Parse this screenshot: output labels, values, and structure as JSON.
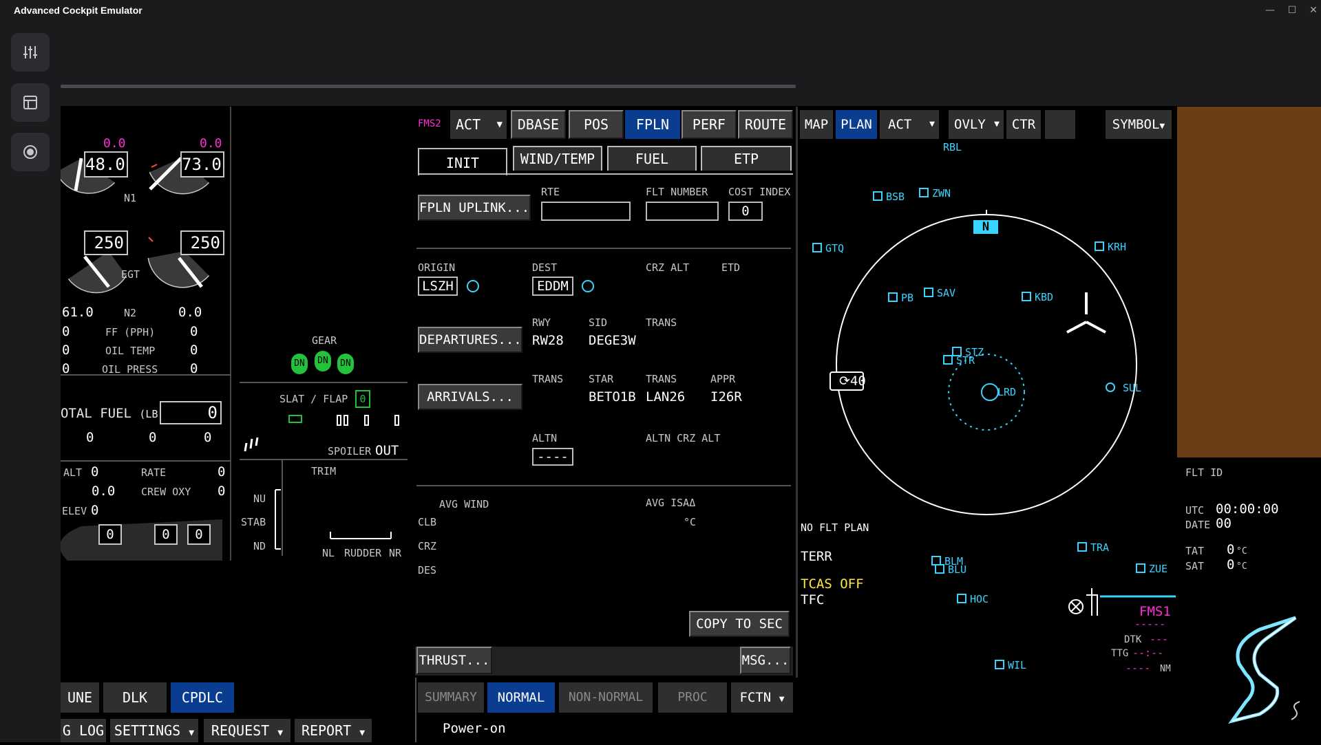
{
  "app": {
    "title": "Advanced Cockpit Emulator"
  },
  "window": {
    "minimize": "—",
    "maximize": "☐",
    "close": "✕"
  },
  "sidebar": {
    "items": [
      {
        "icon": "sliders-icon"
      },
      {
        "icon": "layout-icon"
      },
      {
        "icon": "record-icon"
      }
    ]
  },
  "engine": {
    "n1_left_top": "0.0",
    "n1_right_top": "0.0",
    "n1_left": "48.0",
    "n1_right": "73.0",
    "n1_label": "N1",
    "egt_left": "250",
    "egt_right": "250",
    "egt_label": "EGT",
    "n2_left": "61.0",
    "n2_label": "N2",
    "n2_right": "0.0",
    "ff_left": "0",
    "ff_label": "FF (PPH)",
    "ff_right": "0",
    "oil_temp_left": "0",
    "oil_temp_label": "OIL TEMP",
    "oil_temp_right": "0",
    "oil_press_left": "0",
    "oil_press_label": "OIL PRESS",
    "oil_press_right": "0",
    "total_fuel_label": "OTAL FUEL",
    "total_fuel_unit": "(LB)",
    "total_fuel_value": "0",
    "fuel_tanks": [
      "0",
      "0",
      "0"
    ],
    "alt_label": "ALT",
    "alt_value": "0",
    "rate_label": "RATE",
    "rate_value": "0",
    "cab_value": "0.0",
    "crew_oxy_label": "CREW OXY",
    "crew_oxy_value": "0",
    "elev_label": "ELEV",
    "elev_value": "0",
    "bottom_boxes": [
      "0",
      "0",
      "0"
    ]
  },
  "gear": {
    "label": "GEAR",
    "states": [
      "DN",
      "DN",
      "DN"
    ],
    "slat_flap_label": "SLAT / FLAP",
    "slat_flap_value": "0",
    "spoiler_label": "SPOILER",
    "spoiler_value": "OUT",
    "trim_label": "TRIM",
    "trim_nu": "NU",
    "trim_stab": "STAB",
    "trim_nd": "ND",
    "rudder_nl": "NL",
    "rudder_label": "RUDDER",
    "rudder_nr": "NR"
  },
  "fms": {
    "label": "FMS2",
    "act": "ACT",
    "top_buttons": [
      "DBASE",
      "POS",
      "FPLN",
      "PERF",
      "ROUTE"
    ],
    "tabs": [
      "INIT",
      "WIND/TEMP",
      "FUEL",
      "ETP"
    ],
    "fpln_uplink": "FPLN UPLINK...",
    "rte_label": "RTE",
    "flt_number_label": "FLT NUMBER",
    "cost_index_label": "COST INDEX",
    "cost_index_value": "0",
    "origin_label": "ORIGIN",
    "origin_value": "LSZH",
    "dest_label": "DEST",
    "dest_value": "EDDM",
    "crz_alt_label": "CRZ ALT",
    "etd_label": "ETD",
    "departures_button": "DEPARTURES...",
    "rwy_label": "RWY",
    "rwy_value": "RW28",
    "sid_label": "SID",
    "sid_value": "DEGE3W",
    "trans_label": "TRANS",
    "arrivals_button": "ARRIVALS...",
    "star_label": "STAR",
    "star_value": "BETO1B",
    "trans2_value": "LAN26",
    "appr_label": "APPR",
    "appr_value": "I26R",
    "altn_label": "ALTN",
    "altn_value": "----",
    "altn_crz_alt_label": "ALTN CRZ ALT",
    "avg_wind_label": "AVG WIND",
    "avg_isa_label": "AVG ISAΔ",
    "clb": "CLB",
    "crz": "CRZ",
    "des": "DES",
    "deg_c": "°C",
    "copy_to_sec": "COPY TO SEC",
    "thrust_button": "THRUST...",
    "msg_button": "MSG..."
  },
  "bottom": {
    "left_buttons": [
      "UNE",
      "DLK",
      "CPDLC"
    ],
    "left_menus": [
      "G LOG",
      "SETTINGS",
      "REQUEST",
      "REPORT"
    ],
    "checklist_tabs": [
      "SUMMARY",
      "NORMAL",
      "NON-NORMAL",
      "PROC",
      "FCTN"
    ],
    "checklist_item": "Power-on"
  },
  "map": {
    "buttons": [
      "MAP",
      "PLAN",
      "ACT",
      "OVLY",
      "CTR",
      "",
      "SYMBOL"
    ],
    "range": "40",
    "north": "N",
    "no_flt_plan": "NO FLT PLAN",
    "terr": "TERR",
    "tcas_off": "TCAS OFF",
    "tfc": "TFC",
    "fms_label": "FMS1",
    "fms_dashes1": "-----",
    "dtk_label": "DTK",
    "dtk_value": "---",
    "ttg_label": "TTG",
    "ttg_value": "--:--",
    "dist_value": "----",
    "nm": "NM",
    "waypoints": [
      "RBL",
      "BSB",
      "ZWN",
      "GTQ",
      "KRH",
      "PB",
      "SAV",
      "KBD",
      "STZ",
      "STR",
      "LRD",
      "SUL",
      "TRA",
      "BLM",
      "BLU",
      "ZUE",
      "HOC",
      "WIL"
    ]
  },
  "info": {
    "flt_id_label": "FLT ID",
    "utc_label": "UTC",
    "utc_value": "00:00:00",
    "date_label": "DATE",
    "date_value": "00",
    "tat_label": "TAT",
    "tat_value": "0",
    "sat_label": "SAT",
    "sat_value": "0",
    "unit": "°C"
  },
  "colors": {
    "accent_blue": "#0a3d8f",
    "fms_magenta": "#ff2bd6",
    "nav_cyan": "#3ad3ff",
    "gear_green": "#22c33a",
    "terrain_brown": "#6a3f17"
  }
}
